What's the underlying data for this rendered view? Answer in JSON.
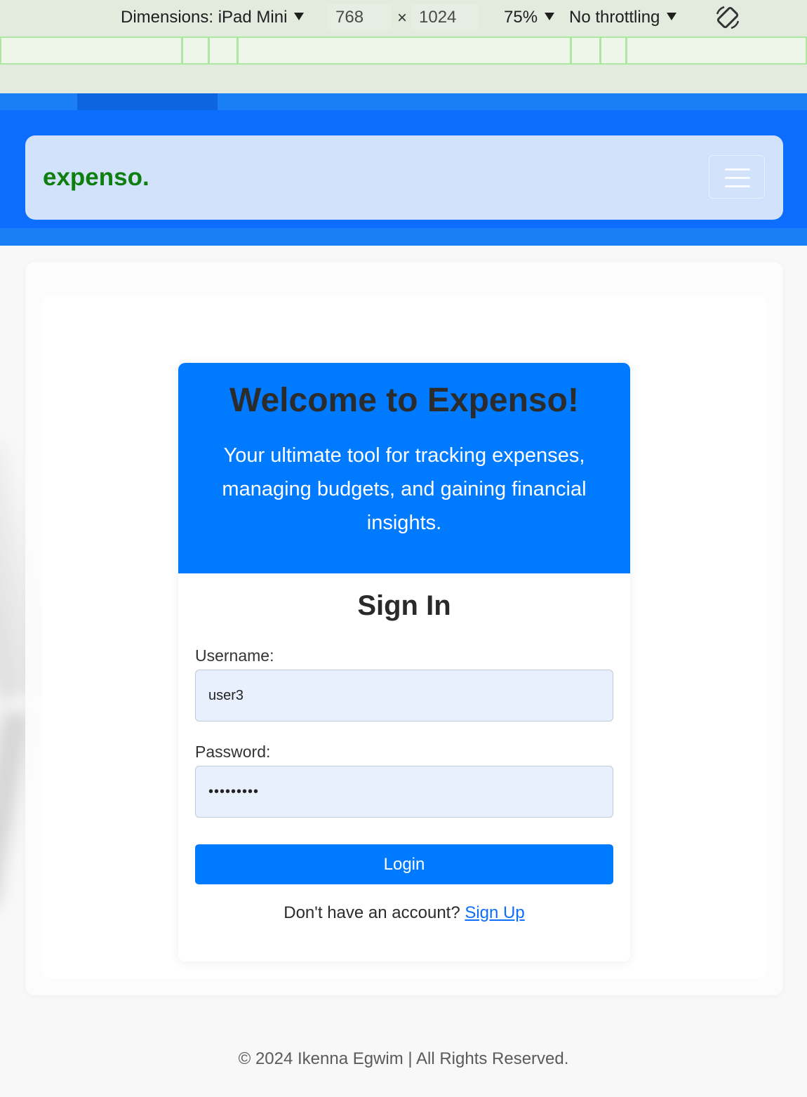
{
  "devtools": {
    "dimensions_label": "Dimensions: iPad Mini",
    "width_value": "768",
    "times": "×",
    "height_value": "1024",
    "zoom": "75%",
    "throttling": "No throttling"
  },
  "navbar": {
    "brand": "expenso.",
    "brand_color": "#0e7f0e"
  },
  "hero": {
    "title": "Welcome to Expenso!",
    "subtitle": "Your ultimate tool for tracking expenses, managing budgets, and gaining financial insights."
  },
  "signin": {
    "title": "Sign In",
    "username_label": "Username:",
    "username_value": "user3",
    "password_label": "Password:",
    "password_value": "•••••••••",
    "login_label": "Login",
    "signup_prompt": "Don't have an account?",
    "signup_link": "Sign Up"
  },
  "footer": {
    "text": "© 2024 Ikenna Egwim | All Rights Reserved."
  },
  "colors": {
    "primary": "#007bff",
    "header": "#0d6efd"
  }
}
